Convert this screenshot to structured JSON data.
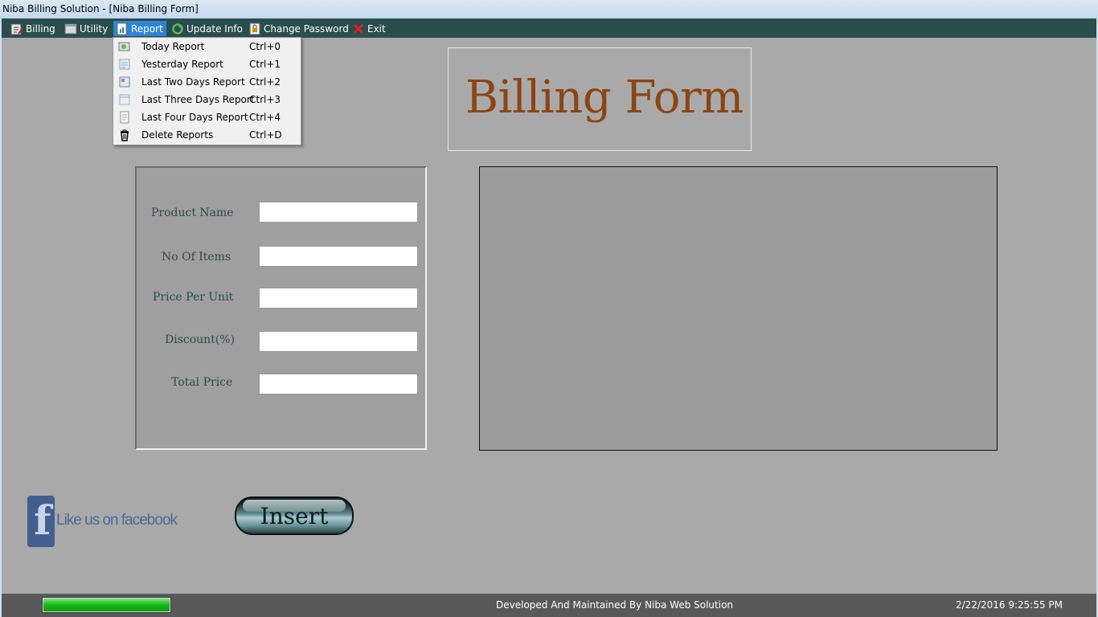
{
  "window": {
    "title": "Niba Billing Solution - [Niba Billing Form]"
  },
  "menubar": {
    "items": [
      {
        "label": "Billing",
        "icon": "billing-icon"
      },
      {
        "label": "Utility",
        "icon": "utility-icon"
      },
      {
        "label": "Report",
        "icon": "report-icon",
        "active": true
      },
      {
        "label": "Update Info",
        "icon": "refresh-icon"
      },
      {
        "label": "Change Password",
        "icon": "password-icon"
      },
      {
        "label": "Exit",
        "icon": "exit-icon"
      }
    ]
  },
  "report_menu": {
    "items": [
      {
        "label": "Today Report",
        "shortcut": "Ctrl+0",
        "icon": "today-report-icon"
      },
      {
        "label": "Yesterday Report",
        "shortcut": "Ctrl+1",
        "icon": "yesterday-report-icon"
      },
      {
        "label": "Last Two Days Report",
        "shortcut": "Ctrl+2",
        "icon": "two-days-report-icon"
      },
      {
        "label": "Last Three Days Report",
        "shortcut": "Ctrl+3",
        "icon": "three-days-report-icon"
      },
      {
        "label": "Last Four Days Report",
        "shortcut": "Ctrl+4",
        "icon": "four-days-report-icon"
      },
      {
        "label": "Delete Reports",
        "shortcut": "Ctrl+D",
        "icon": "delete-reports-icon"
      }
    ]
  },
  "main": {
    "heading": "Billing Form",
    "form": {
      "product_name_label": "Product Name",
      "product_name_value": "",
      "no_of_items_label": "No Of Items",
      "no_of_items_value": "",
      "price_per_unit_label": "Price Per Unit",
      "price_per_unit_value": "",
      "discount_label": "Discount(%)",
      "discount_value": "",
      "total_price_label": "Total Price",
      "total_price_value": ""
    },
    "facebook": {
      "text": "Like us on facebook",
      "letter": "f"
    },
    "insert_label": "Insert"
  },
  "statusbar": {
    "progress": 1.0,
    "progress_color": "#13b813",
    "text": "Developed  And Maintained By Niba Web Solution",
    "datetime": "2/22/2016 9:25:55 PM"
  },
  "colors": {
    "menubar_bg": "#2a4d4e",
    "active_menu": "#2f83d2",
    "heading_color": "#8b4513",
    "background": "#a9a9a9"
  }
}
